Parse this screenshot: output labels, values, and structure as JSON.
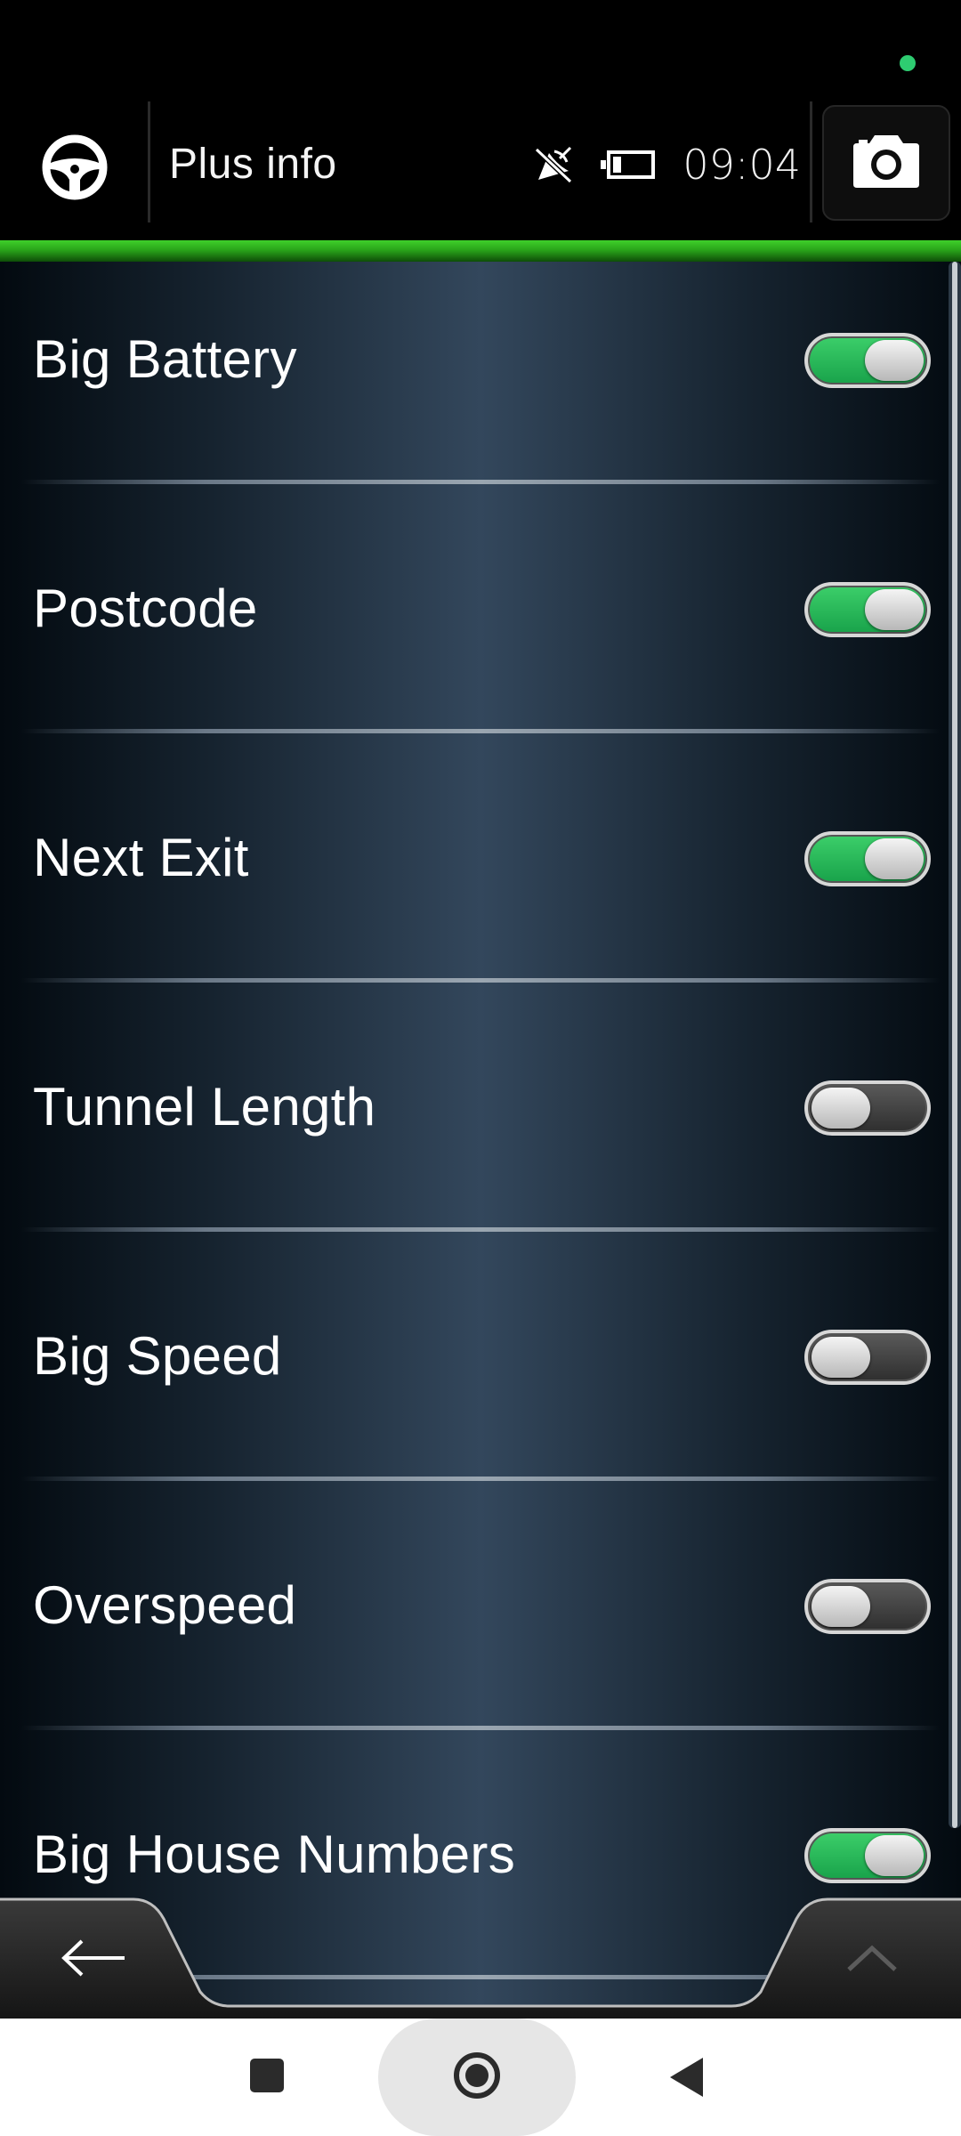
{
  "header": {
    "title": "Plus info",
    "time": "09:04",
    "icons": [
      "steering-wheel-icon",
      "gps-off-icon",
      "battery-icon",
      "camera-icon"
    ]
  },
  "settings": [
    {
      "label": "Big Battery",
      "enabled": true
    },
    {
      "label": "Postcode",
      "enabled": true
    },
    {
      "label": "Next Exit",
      "enabled": true
    },
    {
      "label": "Tunnel Length",
      "enabled": false
    },
    {
      "label": "Big Speed",
      "enabled": false
    },
    {
      "label": "Overspeed",
      "enabled": false
    },
    {
      "label": "Big House Numbers",
      "enabled": true
    }
  ],
  "footer": {
    "icons": [
      "back-arrow-icon",
      "chevron-up-icon"
    ]
  },
  "system_nav": {
    "icons": [
      "recents-square-icon",
      "home-circle-icon",
      "back-triangle-icon"
    ]
  },
  "colors": {
    "accent_green": "#2aa51a",
    "toggle_on": "#18a24a",
    "status_dot": "#2ecc71"
  }
}
